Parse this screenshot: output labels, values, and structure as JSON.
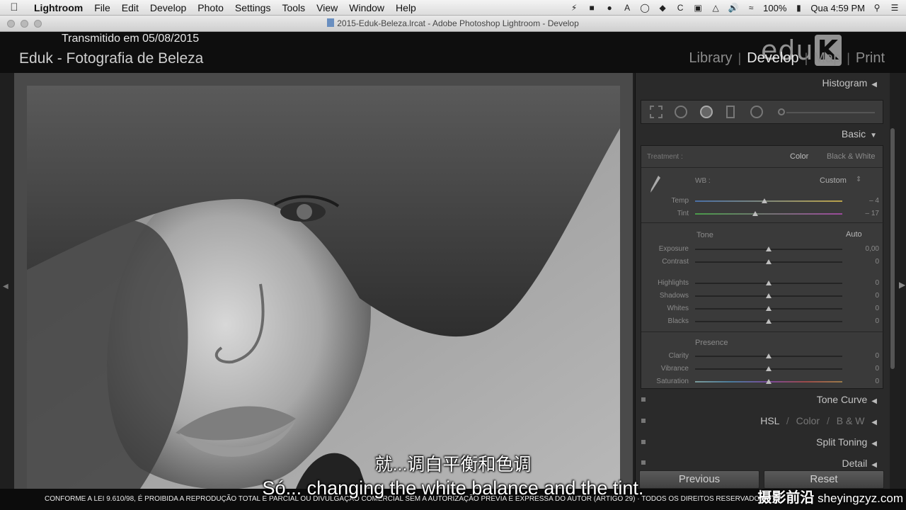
{
  "menubar": {
    "apple_icon": "apple-logo",
    "items": [
      "Lightroom",
      "File",
      "Edit",
      "Develop",
      "Photo",
      "Settings",
      "Tools",
      "View",
      "Window",
      "Help"
    ],
    "battery": "100%",
    "clock": "Qua 4:59 PM"
  },
  "window": {
    "title": "2015-Eduk-Beleza.lrcat - Adobe Photoshop Lightroom - Develop"
  },
  "header": {
    "broadcast_date": "Transmitido em 05/08/2015",
    "identity_plate": "Eduk - Fotografia de Beleza",
    "modules": [
      "Library",
      "Develop",
      "Map",
      "Print"
    ],
    "active_module": "Develop",
    "watermark_text": "edu",
    "watermark_k": "K"
  },
  "panel": {
    "histogram": "Histogram",
    "basic": "Basic",
    "treatment": {
      "label": "Treatment :",
      "color": "Color",
      "bw": "Black & White"
    },
    "wb": {
      "label": "WB :",
      "value": "Custom"
    },
    "sliders_wb": [
      {
        "label": "Temp",
        "value": "– 4",
        "pos": 0.47
      },
      {
        "label": "Tint",
        "value": "– 17",
        "pos": 0.41
      }
    ],
    "tone": {
      "label": "Tone",
      "auto": "Auto"
    },
    "sliders_tone": [
      {
        "label": "Exposure",
        "value": "0,00",
        "pos": 0.5
      },
      {
        "label": "Contrast",
        "value": "0",
        "pos": 0.5
      }
    ],
    "sliders_tone2": [
      {
        "label": "Highlights",
        "value": "0",
        "pos": 0.5
      },
      {
        "label": "Shadows",
        "value": "0",
        "pos": 0.5
      },
      {
        "label": "Whites",
        "value": "0",
        "pos": 0.5
      },
      {
        "label": "Blacks",
        "value": "0",
        "pos": 0.5
      }
    ],
    "presence": {
      "label": "Presence"
    },
    "sliders_presence": [
      {
        "label": "Clarity",
        "value": "0",
        "pos": 0.5
      },
      {
        "label": "Vibrance",
        "value": "0",
        "pos": 0.5
      },
      {
        "label": "Saturation",
        "value": "0",
        "pos": 0.5
      }
    ],
    "tone_curve": "Tone Curve",
    "hsl": {
      "hsl": "HSL",
      "color": "Color",
      "bw": "B & W",
      "sep": "/"
    },
    "split_toning": "Split Toning",
    "detail": "Detail",
    "previous": "Previous",
    "reset": "Reset"
  },
  "legal": "CONFORME A LEI 9.610/98, É PROIBIDA A REPRODUÇÃO TOTAL E PARCIAL OU DIVULGAÇÃO COMERCIAL SEM A AUTORIZAÇÃO PRÉVIA E EXPRESSA DO AUTOR (ARTIGO 29)  ·  TODOS OS DIREITOS RESERVADOS",
  "subtitles": {
    "zh": "就...调白平衡和色调",
    "en": "Só... changing the white balance and the tint."
  },
  "site_mark": {
    "zh": "摄影前沿",
    "url": "sheyingzyz.com"
  }
}
